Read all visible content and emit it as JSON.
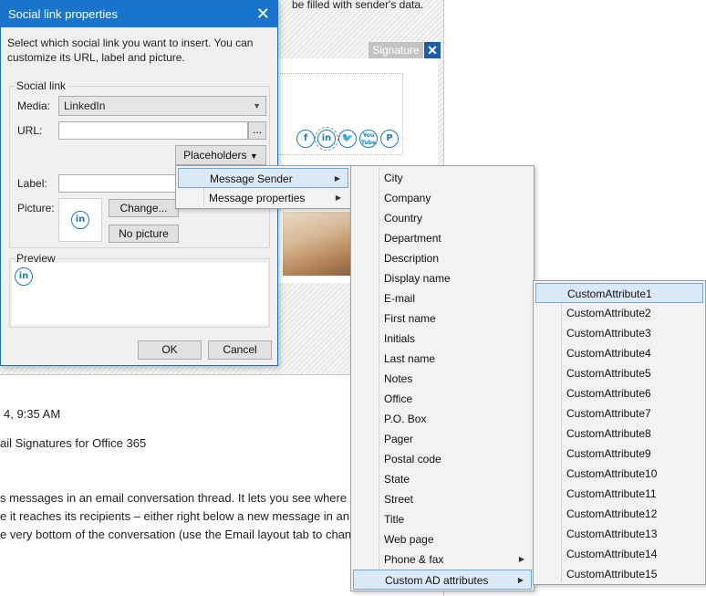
{
  "background": {
    "top_text": "be filled with sender's data.",
    "signature_tab": "Signature",
    "signature_close": "✕",
    "social_icons": [
      "f",
      "in",
      "🐦",
      "You Tube",
      "P"
    ],
    "lines": [
      "4, 9:35 AM",
      "ail Signatures for Office 365",
      "s messages in an email conversation thread. It lets you see where",
      "e it reaches its recipients – either right below a new message in an",
      "e very bottom of the conversation (use the Email layout tab to chan"
    ]
  },
  "dialog": {
    "title": "Social link properties",
    "close": "✕",
    "description": "Select which social link you want to insert. You can customize its URL, label and picture.",
    "group_social": "Social link",
    "media_label": "Media:",
    "media_value": "LinkedIn",
    "url_label": "URL:",
    "url_value": "",
    "browse_label": "...",
    "placeholders_label": "Placeholders",
    "label_label": "Label:",
    "label_value": "",
    "picture_label": "Picture:",
    "picture_icon": "in",
    "change_label": "Change...",
    "no_picture_label": "No picture",
    "group_preview": "Preview",
    "preview_icon": "in",
    "ok_label": "OK",
    "cancel_label": "Cancel"
  },
  "menu1": {
    "items": [
      {
        "label": "Message Sender",
        "submenu": true,
        "highlighted": true
      },
      {
        "label": "Message properties",
        "submenu": true,
        "highlighted": false
      }
    ]
  },
  "menu2": {
    "items": [
      {
        "label": "City"
      },
      {
        "label": "Company"
      },
      {
        "label": "Country"
      },
      {
        "label": "Department"
      },
      {
        "label": "Description"
      },
      {
        "label": "Display name"
      },
      {
        "label": "E-mail"
      },
      {
        "label": "First name"
      },
      {
        "label": "Initials"
      },
      {
        "label": "Last name"
      },
      {
        "label": "Notes"
      },
      {
        "label": "Office"
      },
      {
        "label": "P.O. Box"
      },
      {
        "label": "Pager"
      },
      {
        "label": "Postal code"
      },
      {
        "label": "State"
      },
      {
        "label": "Street"
      },
      {
        "label": "Title"
      },
      {
        "label": "Web page"
      },
      {
        "label": "Phone & fax",
        "submenu": true
      },
      {
        "label": "Custom AD attributes",
        "submenu": true,
        "highlighted": true
      }
    ]
  },
  "menu3": {
    "items": [
      {
        "label": "CustomAttribute1",
        "highlighted": true
      },
      {
        "label": "CustomAttribute2"
      },
      {
        "label": "CustomAttribute3"
      },
      {
        "label": "CustomAttribute4"
      },
      {
        "label": "CustomAttribute5"
      },
      {
        "label": "CustomAttribute6"
      },
      {
        "label": "CustomAttribute7"
      },
      {
        "label": "CustomAttribute8"
      },
      {
        "label": "CustomAttribute9"
      },
      {
        "label": "CustomAttribute10"
      },
      {
        "label": "CustomAttribute11"
      },
      {
        "label": "CustomAttribute12"
      },
      {
        "label": "CustomAttribute13"
      },
      {
        "label": "CustomAttribute14"
      },
      {
        "label": "CustomAttribute15"
      }
    ]
  },
  "submenu_arrow": "▶",
  "combo_arrow": "▼",
  "colors": {
    "accent": "#1874cd",
    "highlight": "#dbe9f6",
    "icon_blue": "#1f7bc0"
  }
}
